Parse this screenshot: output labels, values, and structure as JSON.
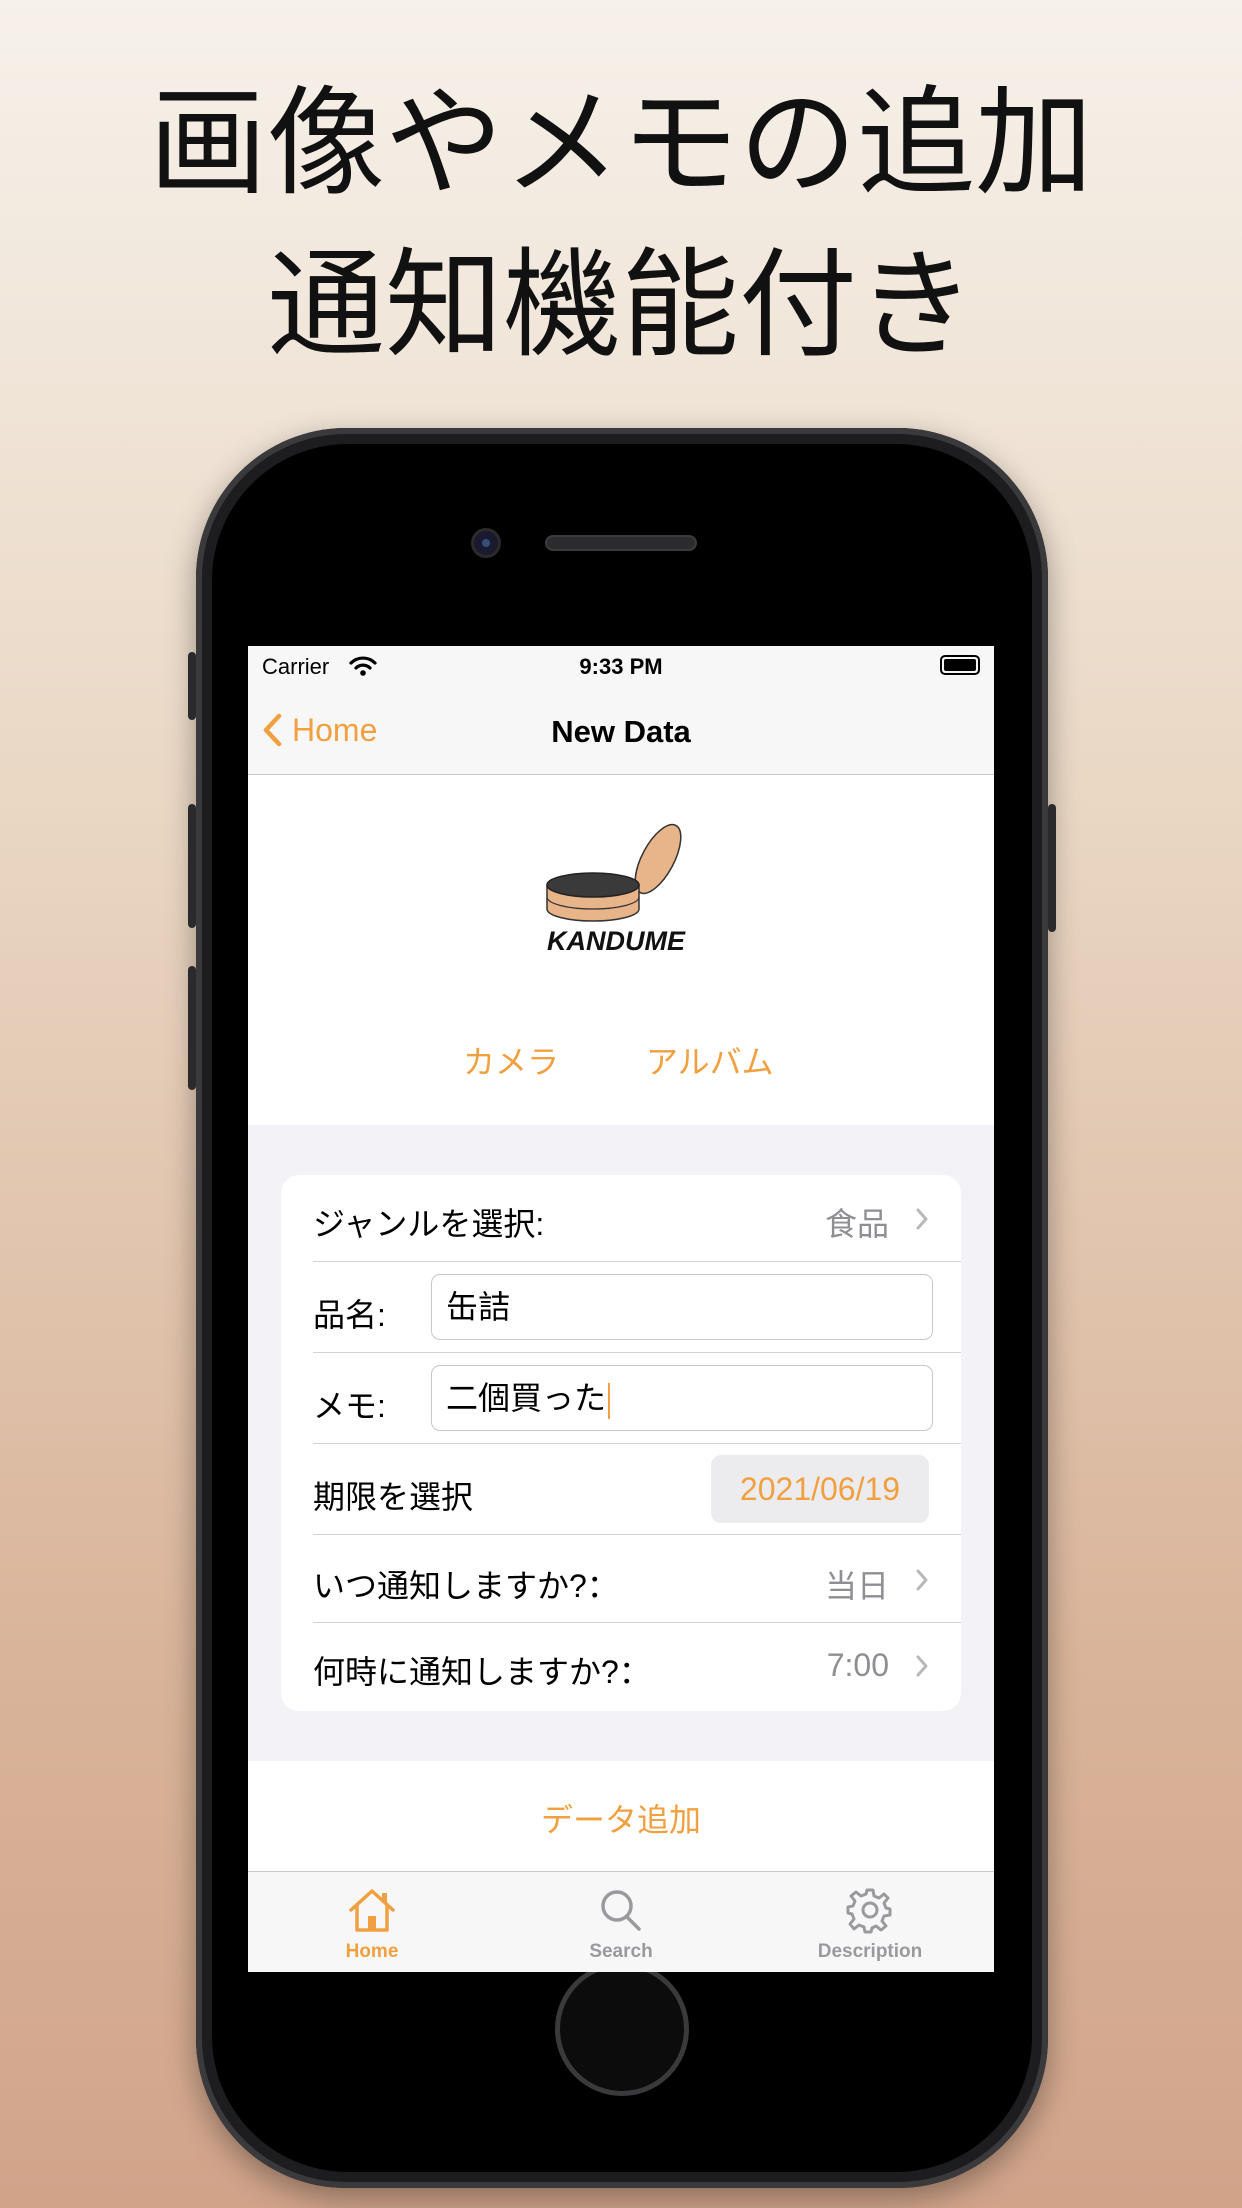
{
  "headline": {
    "line1": "画像やメモの追加",
    "line2": "通知機能付き"
  },
  "status_bar": {
    "carrier": "Carrier",
    "time": "9:33 PM"
  },
  "nav": {
    "back_label": "Home",
    "title": "New Data"
  },
  "image_section": {
    "logo_text": "KANDUME",
    "camera_button": "カメラ",
    "album_button": "アルバム"
  },
  "form": {
    "genre": {
      "label": "ジャンルを選択:",
      "value": "食品"
    },
    "name": {
      "label": "品名:",
      "value": "缶詰"
    },
    "memo": {
      "label": "メモ:",
      "value": "二個買った"
    },
    "expiry": {
      "label": "期限を選択",
      "value": "2021/06/19"
    },
    "notify_when": {
      "label": "いつ通知しますか?：",
      "value": "当日"
    },
    "notify_time": {
      "label": "何時に通知しますか?：",
      "value": "7:00"
    }
  },
  "add_button": "データ追加",
  "tabbar": {
    "items": [
      {
        "label": "Home",
        "icon": "house-icon",
        "active": true
      },
      {
        "label": "Search",
        "icon": "magnifier-icon",
        "active": false
      },
      {
        "label": "Description",
        "icon": "gear-icon",
        "active": false
      }
    ]
  },
  "colors": {
    "accent": "#f0a040",
    "secondary_text": "#8e8e93",
    "inactive_tab": "#9a9a9e"
  }
}
